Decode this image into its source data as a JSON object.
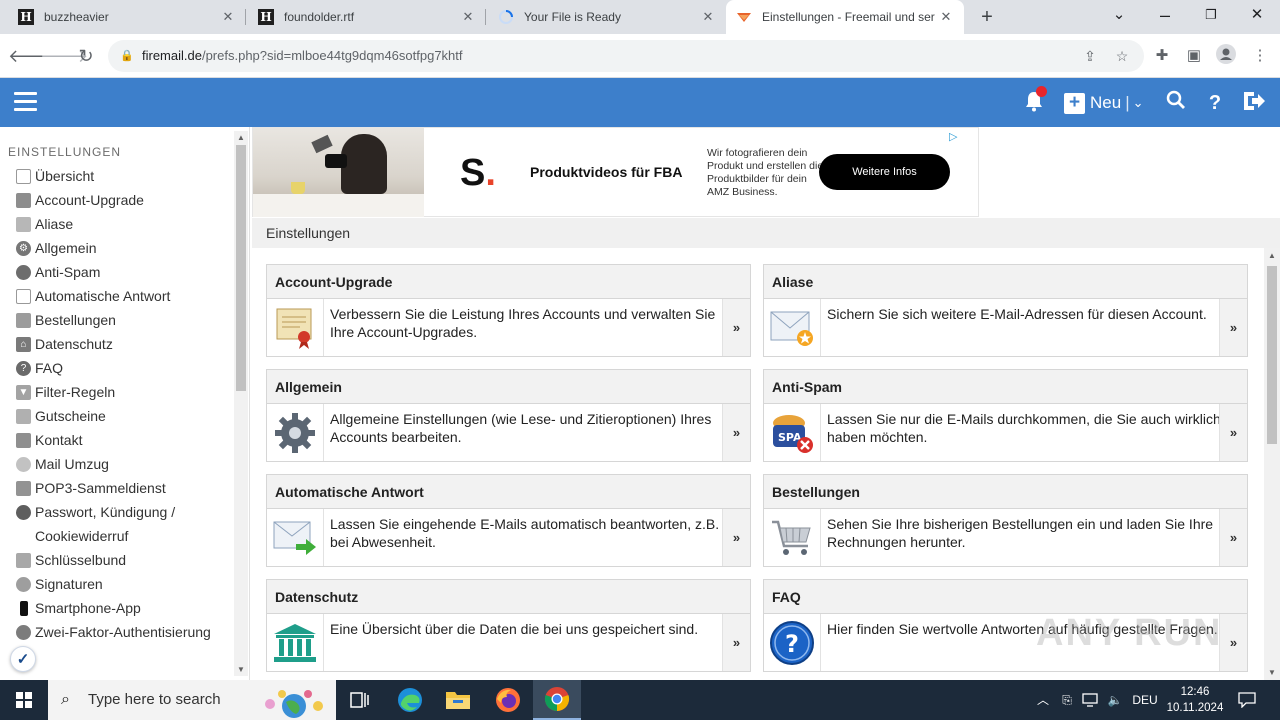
{
  "browser": {
    "tabs": [
      {
        "title": "buzzheavier",
        "favicon": "H"
      },
      {
        "title": "foundolder.rtf",
        "favicon": "H"
      },
      {
        "title": "Your File is Ready",
        "favicon": "loading-spinner-icon"
      },
      {
        "title": "Einstellungen - Freemail und ser",
        "favicon": "freemail-logo-icon"
      }
    ],
    "close_glyph": "✕",
    "new_tab_glyph": "+",
    "url_domain": "firemail.de",
    "url_path": "/prefs.php?sid=mlboe44tg9dqm46sotfpg7khtf"
  },
  "header": {
    "new_label": "Neu",
    "accent": "#3d7fcb"
  },
  "ad": {
    "logo": "S",
    "logo_dot": ".",
    "headline": "Produktvideos für FBA",
    "description": "Wir fotografieren dein Produkt und erstellen die Produktbilder für dein AMZ Business.",
    "cta": "Weitere Infos"
  },
  "sidebar": {
    "heading": "EINSTELLUNGEN",
    "items": [
      {
        "label": "Übersicht",
        "icon": "overview-icon"
      },
      {
        "label": "Account-Upgrade",
        "icon": "upgrade-icon"
      },
      {
        "label": "Aliase",
        "icon": "alias-icon"
      },
      {
        "label": "Allgemein",
        "icon": "gear-icon"
      },
      {
        "label": "Anti-Spam",
        "icon": "spam-icon"
      },
      {
        "label": "Automatische Antwort",
        "icon": "autoreply-icon"
      },
      {
        "label": "Bestellungen",
        "icon": "cart-icon"
      },
      {
        "label": "Datenschutz",
        "icon": "privacy-icon"
      },
      {
        "label": "FAQ",
        "icon": "help-icon"
      },
      {
        "label": "Filter-Regeln",
        "icon": "filter-icon"
      },
      {
        "label": "Gutscheine",
        "icon": "voucher-icon"
      },
      {
        "label": "Kontakt",
        "icon": "contact-icon"
      },
      {
        "label": "Mail Umzug",
        "icon": "move-icon"
      },
      {
        "label": "POP3-Sammeldienst",
        "icon": "pop3-icon"
      },
      {
        "label": "Passwort, Kündigung / Cookiewiderruf",
        "icon": "user-icon"
      },
      {
        "label": "Schlüsselbund",
        "icon": "key-icon"
      },
      {
        "label": "Signaturen",
        "icon": "signature-icon"
      },
      {
        "label": "Smartphone-App",
        "icon": "smartphone-icon"
      },
      {
        "label": "Zwei-Faktor-Authentisierung",
        "icon": "two-factor-icon"
      }
    ]
  },
  "main": {
    "title": "Einstellungen",
    "arrow": "»",
    "cards": [
      {
        "title": "Account-Upgrade",
        "text": "Verbessern Sie die Leistung Ihres Accounts und verwalten Sie Ihre Account-Upgrades.",
        "icon": "certificate-icon"
      },
      {
        "title": "Aliase",
        "text": "Sichern Sie sich weitere E-Mail-Adressen für diesen Account.",
        "icon": "envelope-star-icon"
      },
      {
        "title": "Allgemein",
        "text": "Allgemeine Einstellungen (wie Lese- und Zitieroptionen) Ihres Accounts bearbeiten.",
        "icon": "gear-icon"
      },
      {
        "title": "Anti-Spam",
        "text": "Lassen Sie nur die E-Mails durchkommen, die Sie auch wirklich haben möchten.",
        "icon": "spam-can-icon"
      },
      {
        "title": "Automatische Antwort",
        "text": "Lassen Sie eingehende E-Mails automatisch beantworten, z.B. bei Abwesenheit.",
        "icon": "envelope-arrow-icon"
      },
      {
        "title": "Bestellungen",
        "text": "Sehen Sie Ihre bisherigen Bestellungen ein und laden Sie Ihre Rechnungen herunter.",
        "icon": "shopping-cart-icon"
      },
      {
        "title": "Datenschutz",
        "text": "Eine Übersicht über die Daten die bei uns gespeichert sind.",
        "icon": "building-icon"
      },
      {
        "title": "FAQ",
        "text": "Hier finden Sie wertvolle Antworten auf häufig gestellte Fragen.",
        "icon": "question-icon"
      }
    ]
  },
  "watermark": "ANY RUN",
  "taskbar": {
    "search_placeholder": "Type here to search",
    "lang": "DEU",
    "time": "12:46",
    "date": "10.11.2024"
  }
}
